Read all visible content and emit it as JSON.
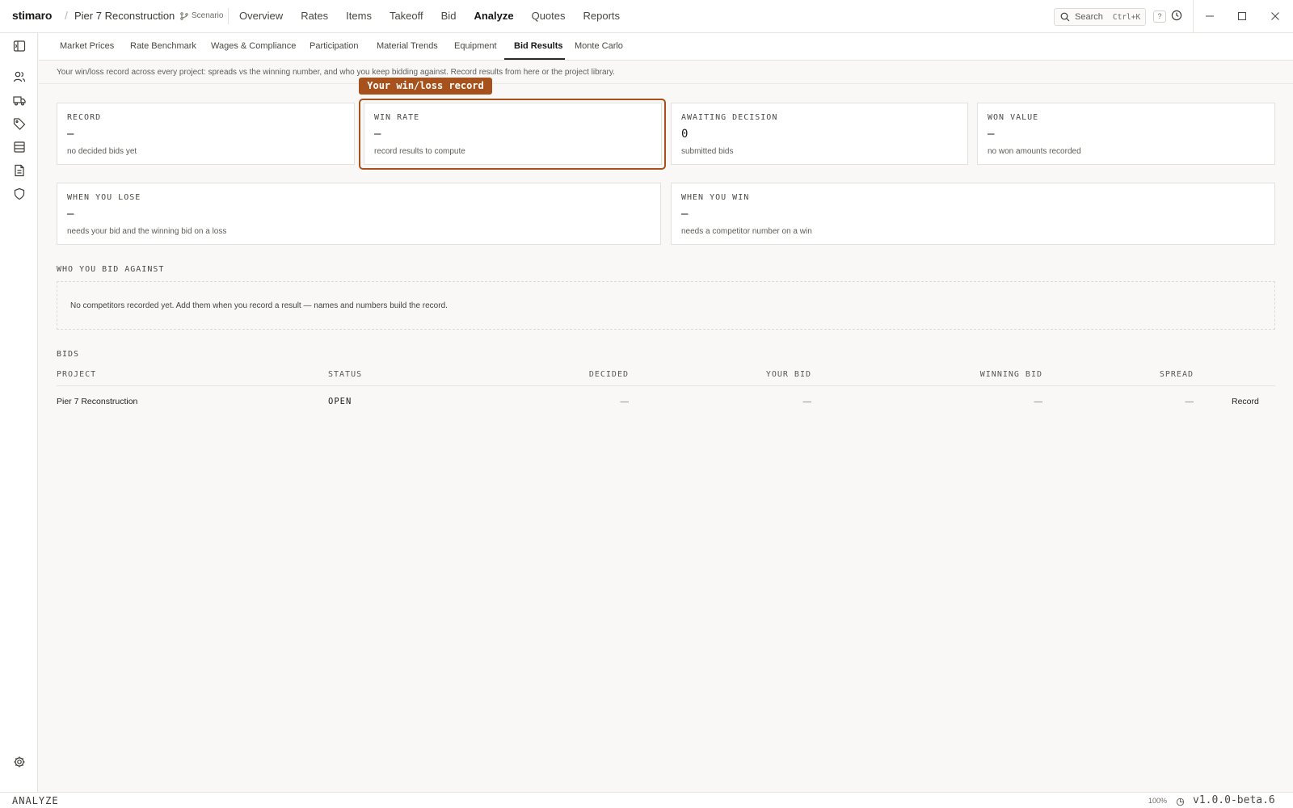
{
  "app": {
    "brand": "stimaro",
    "crumb_separator": "/",
    "project": "Pier 7 Reconstruction",
    "scenario_label": "Scenario"
  },
  "nav": {
    "items": [
      {
        "label": "Overview"
      },
      {
        "label": "Rates"
      },
      {
        "label": "Items"
      },
      {
        "label": "Takeoff"
      },
      {
        "label": "Bid"
      },
      {
        "label": "Analyze",
        "active": true
      },
      {
        "label": "Quotes"
      },
      {
        "label": "Reports"
      }
    ]
  },
  "search": {
    "label": "Search",
    "shortcut": "Ctrl+K"
  },
  "help_label": "?",
  "subtabs": [
    {
      "label": "Market Prices"
    },
    {
      "label": "Rate Benchmark"
    },
    {
      "label": "Wages & Compliance"
    },
    {
      "label": "Participation"
    },
    {
      "label": "Material Trends"
    },
    {
      "label": "Equipment"
    },
    {
      "label": "Bid Results",
      "active": true
    },
    {
      "label": "Monte Carlo"
    }
  ],
  "intro": "Your win/loss record across every project: spreads vs the winning number, and who you keep bidding against. Record results from here or the project library.",
  "callout": "Your win/loss record",
  "stats": [
    {
      "title": "RECORD",
      "value": "—",
      "sub": "no decided bids yet"
    },
    {
      "title": "WIN RATE",
      "value": "—",
      "sub": "record results to compute"
    },
    {
      "title": "AWAITING DECISION",
      "value": "0",
      "sub": "submitted bids"
    },
    {
      "title": "WON VALUE",
      "value": "—",
      "sub": "no won amounts recorded"
    }
  ],
  "spreads": [
    {
      "title": "WHEN YOU LOSE",
      "value": "—",
      "sub": "needs your bid and the winning bid on a loss"
    },
    {
      "title": "WHEN YOU WIN",
      "value": "—",
      "sub": "needs a competitor number on a win"
    }
  ],
  "competitors": {
    "heading": "WHO YOU BID AGAINST",
    "empty_message": "No competitors recorded yet. Add them when you record a result — names and numbers build the record."
  },
  "bids": {
    "heading": "BIDS",
    "columns": [
      "PROJECT",
      "STATUS",
      "DECIDED",
      "YOUR BID",
      "WINNING BID",
      "SPREAD"
    ],
    "rows": [
      {
        "project": "Pier 7 Reconstruction",
        "status": "OPEN",
        "decided": "—",
        "your_bid": "—",
        "winning_bid": "—",
        "spread": "—",
        "action": "Record"
      }
    ]
  },
  "statusbar": {
    "mode": "ANALYZE",
    "zoom": "100%",
    "version": "v1.0.0-beta.6"
  },
  "colors": {
    "accent": "#a7521c",
    "background": "#f9f8f6",
    "surface": "#ffffff",
    "border": "#e3e1dc"
  }
}
